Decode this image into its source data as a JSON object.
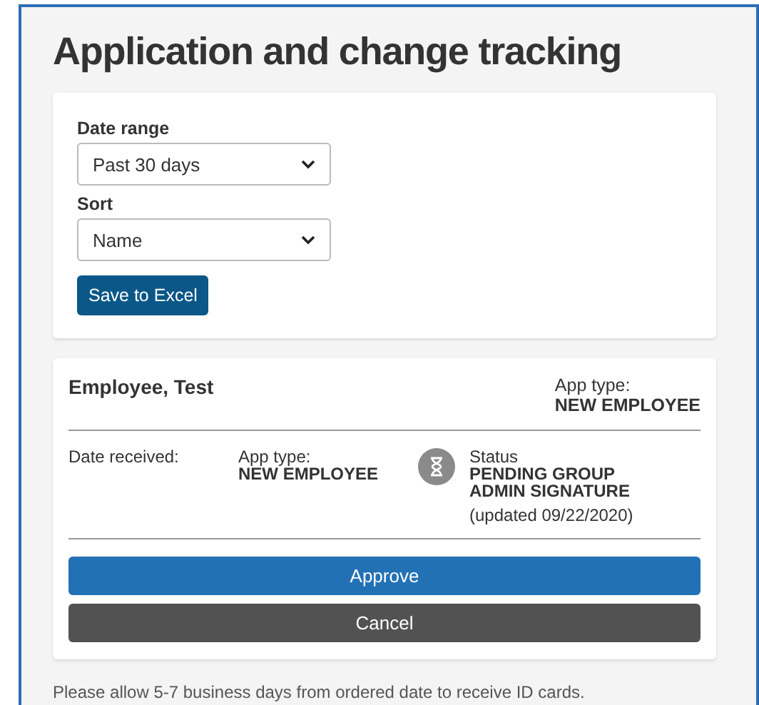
{
  "title": "Application and change tracking",
  "filters": [
    {
      "label": "Date range",
      "value": "Past 30 days"
    },
    {
      "label": "Sort",
      "value": "Name"
    }
  ],
  "export_button": "Save to Excel",
  "record": {
    "name": "Employee, Test",
    "header_app_type_label": "App type:",
    "header_app_type": "NEW EMPLOYEE",
    "date_received_label": "Date received:",
    "app_type_label": "App type:",
    "app_type": "NEW EMPLOYEE",
    "status_label": "Status",
    "status": "PENDING GROUP ADMIN SIGNATURE",
    "updated": "(updated 09/22/2020)",
    "actions": [
      {
        "label": "Approve",
        "kind": "primary"
      },
      {
        "label": "Cancel",
        "kind": "secondary"
      }
    ]
  },
  "footer_note": "Please allow 5-7 business days from ordered date to receive ID cards."
}
